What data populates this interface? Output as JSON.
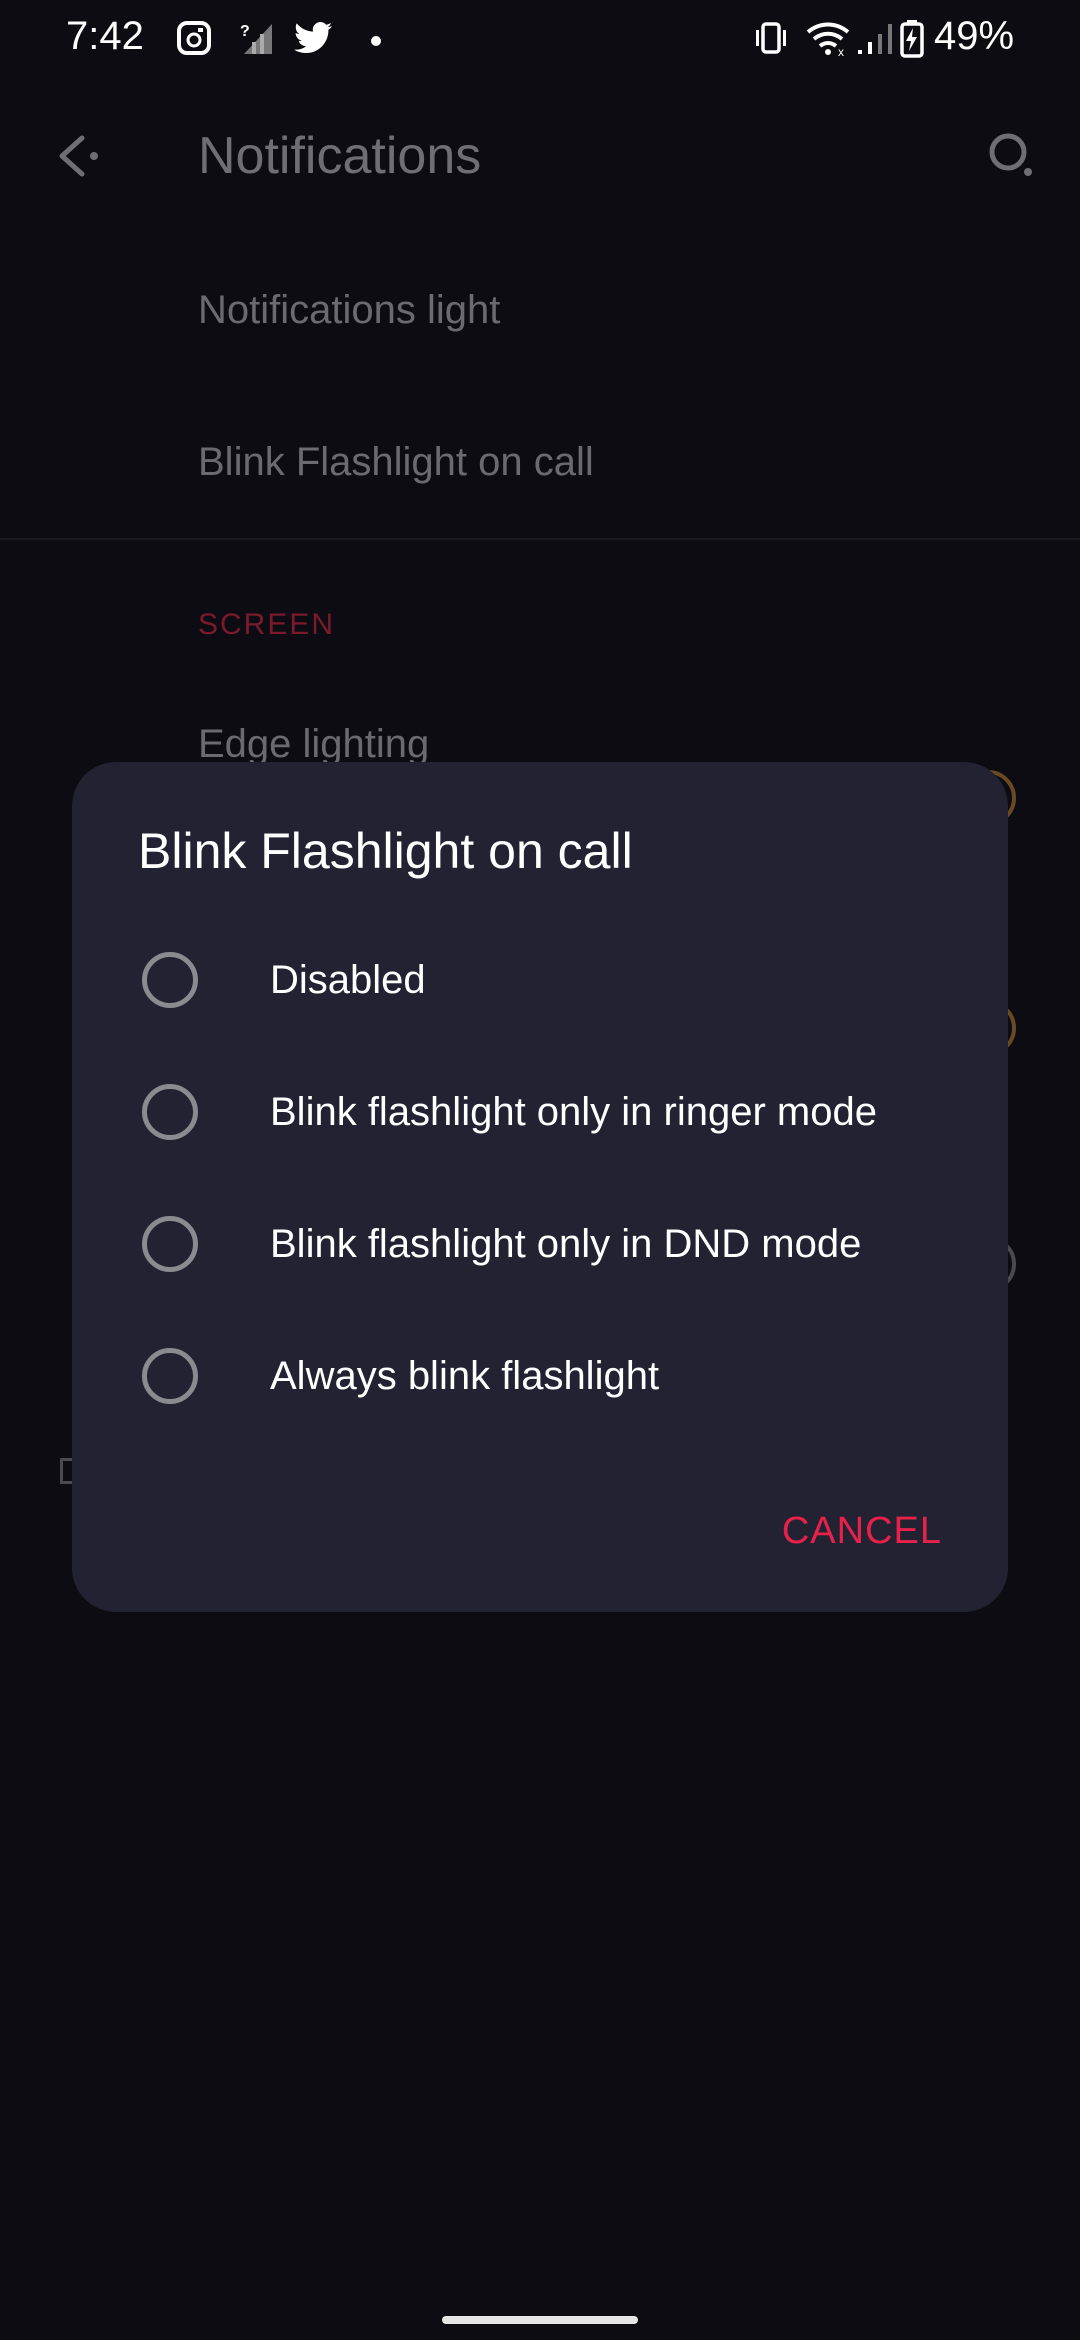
{
  "status_bar": {
    "time": "7:42",
    "battery_percent": "49%",
    "icons": [
      "screenshot-icon",
      "signal-unknown-icon",
      "twitter-icon",
      "notification-dot-icon",
      "vibrate-icon",
      "wifi-icon",
      "cell-signal-icon",
      "battery-charging-icon"
    ]
  },
  "app_bar": {
    "title": "Notifications",
    "back_icon": "back-arrow-icon",
    "search_icon": "search-icon"
  },
  "background_list": {
    "items": [
      {
        "label": "Notifications light"
      },
      {
        "label": "Blink Flashlight on call"
      }
    ],
    "section_header": "SCREEN",
    "section_items": [
      {
        "label": "Edge lighting"
      }
    ]
  },
  "dialog": {
    "title": "Blink Flashlight on call",
    "options": [
      {
        "label": "Disabled",
        "selected": false
      },
      {
        "label": "Blink flashlight only in ringer mode",
        "selected": false
      },
      {
        "label": "Blink flashlight only in DND mode",
        "selected": false
      },
      {
        "label": "Always blink flashlight",
        "selected": false
      }
    ],
    "cancel_label": "CANCEL"
  },
  "colors": {
    "accent": "#e8214a",
    "dialog_bg": "#222232",
    "screen_bg": "#0c0c12"
  }
}
